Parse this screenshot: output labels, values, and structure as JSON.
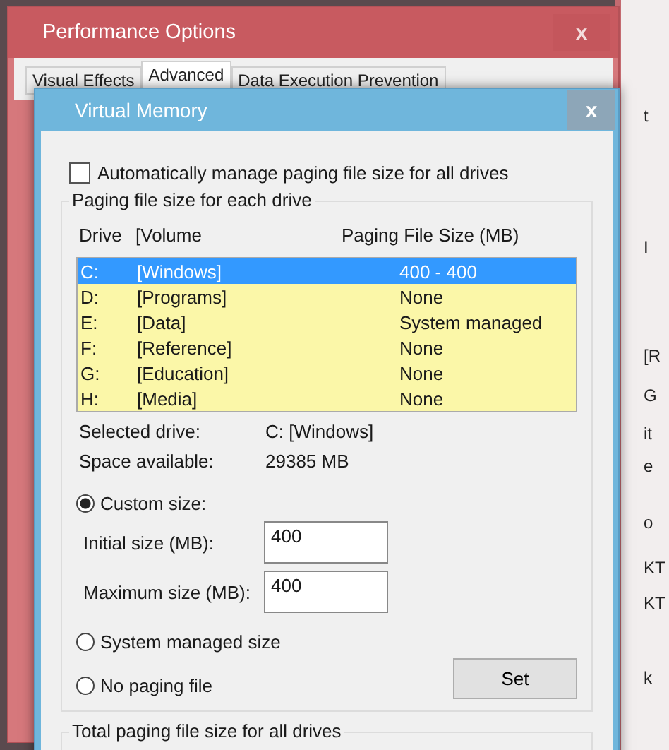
{
  "back_window": {
    "title": "Performance Options",
    "close": "x",
    "tabs": [
      {
        "label": "Visual Effects",
        "selected": false
      },
      {
        "label": "Advanced",
        "selected": true
      },
      {
        "label": "Data Execution Prevention",
        "selected": false
      }
    ],
    "side_fragments": [
      "t",
      "I",
      "[R",
      "G",
      "it",
      "e",
      "o",
      "KT",
      "KT",
      "k"
    ]
  },
  "window": {
    "title": "Virtual Memory",
    "close": "x"
  },
  "auto_manage": {
    "label": "Automatically manage paging file size for all drives",
    "checked": false
  },
  "group": {
    "title": "Paging file size for each drive",
    "columns": [
      "Drive",
      "[Volume",
      "Paging File Size (MB)"
    ],
    "rows": [
      {
        "drive": "C:",
        "volume": "[Windows]",
        "size": "400 - 400",
        "selected": true
      },
      {
        "drive": "D:",
        "volume": "[Programs]",
        "size": "None",
        "selected": false
      },
      {
        "drive": "E:",
        "volume": "[Data]",
        "size": "System managed",
        "selected": false
      },
      {
        "drive": "F:",
        "volume": "[Reference]",
        "size": "None",
        "selected": false
      },
      {
        "drive": "G:",
        "volume": "[Education]",
        "size": "None",
        "selected": false
      },
      {
        "drive": "H:",
        "volume": "[Media]",
        "size": "None",
        "selected": false
      }
    ],
    "info": [
      {
        "label": "Selected drive:",
        "value": "C:  [Windows]"
      },
      {
        "label": "Space available:",
        "value": "29385 MB"
      }
    ],
    "custom": {
      "label": "Custom size:",
      "selected": true
    },
    "fields": [
      {
        "label": "Initial size (MB):",
        "value": "400"
      },
      {
        "label": "Maximum size (MB):",
        "value": "400"
      }
    ],
    "system_managed": {
      "label": "System managed size",
      "selected": false
    },
    "no_paging": {
      "label": "No paging file",
      "selected": false
    },
    "set_button": "Set"
  },
  "total_group": {
    "title": "Total paging file size for all drives"
  }
}
